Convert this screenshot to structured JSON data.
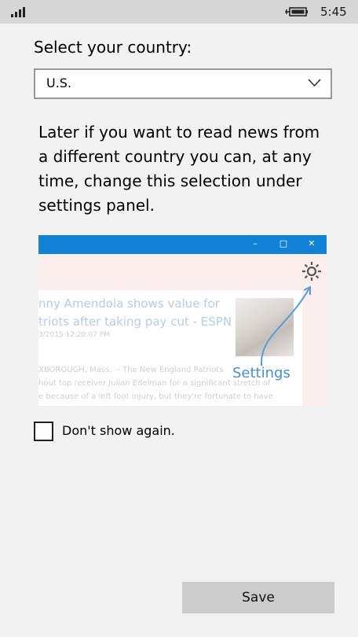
{
  "status_bar": {
    "time": "5:45",
    "signal_icon": "signal-bars-icon",
    "battery_icon": "battery-charging-icon"
  },
  "form": {
    "country_label": "Select your country:",
    "country_value": "U.S.",
    "info_text": "Later if you want to read news from a different country you can, at any time, change this selection under settings panel."
  },
  "preview": {
    "headline_line1": "nny Amendola shows value for",
    "headline_line2": "triots after taking pay cut - ESPN",
    "date": "3/2015 12:20:07 PM",
    "body_line1": "XBOROUGH, Mass. -- The New England Patriots",
    "body_line2": "hout top receiver Julian Edelman for a significant stretch of",
    "body_line3": "e because of a left foot injury, but they're fortunate to have",
    "settings_label": "Settings",
    "titlebar_color": "#1082d5"
  },
  "checkbox": {
    "label": "Don't show again.",
    "checked": false
  },
  "actions": {
    "save_label": "Save"
  }
}
